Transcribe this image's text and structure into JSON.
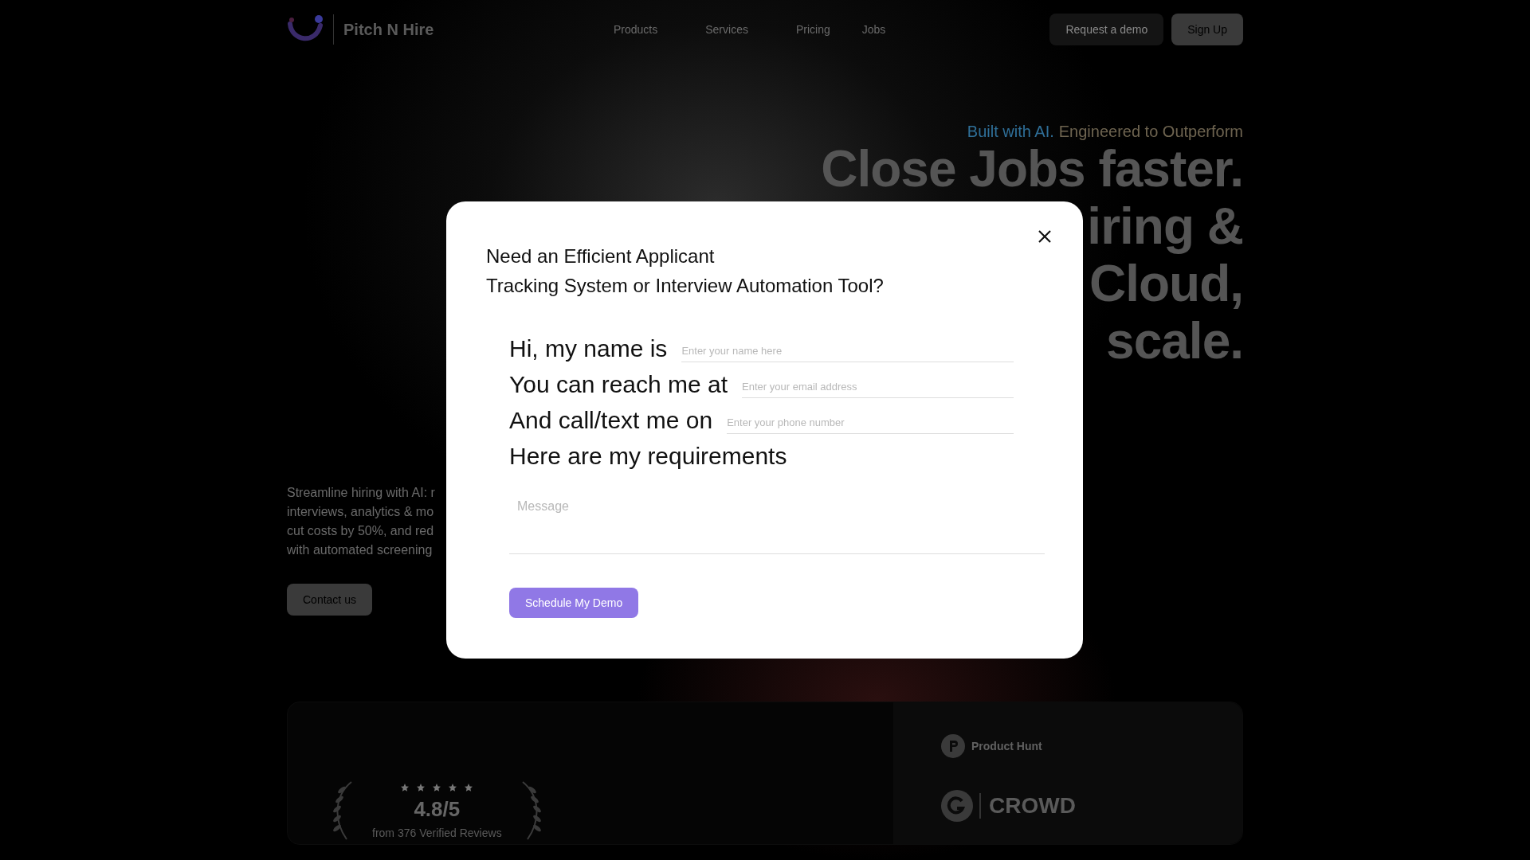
{
  "header": {
    "brand": "Pitch N Hire",
    "nav": [
      "Products",
      "Services",
      "Pricing",
      "Jobs"
    ],
    "buttons": [
      {
        "label": "Request a demo",
        "kind": "secondary"
      },
      {
        "label": "Sign Up",
        "kind": "primary"
      }
    ]
  },
  "hero": {
    "tagline_parts": [
      "Built with AI.",
      "Engineered to Outperform"
    ],
    "headline_lines": [
      "Close Jobs faster.",
      "iring &",
      "Cloud,",
      "scale."
    ],
    "description_lines": [
      "Streamline hiring with AI: r",
      "interviews, analytics & mo",
      "cut costs by 50%, and red",
      "with automated screening"
    ],
    "cta": "Contact us"
  },
  "ratings": {
    "stars": 5,
    "score": "4.8/5",
    "reviews": "from 376 Verified Reviews",
    "badges": [
      {
        "kind": "producthunt",
        "label": "Product Hunt"
      },
      {
        "kind": "g2",
        "label": "CROWD"
      }
    ]
  },
  "modal": {
    "title_lines": [
      "Need an Efficient Applicant",
      "Tracking System or Interview Automation Tool?"
    ],
    "fields": [
      {
        "label": "Hi, my name is",
        "placeholder": "Enter your name here"
      },
      {
        "label": "You can reach me at",
        "placeholder": "Enter your email address"
      },
      {
        "label": "And call/text me on",
        "placeholder": "Enter your phone number"
      }
    ],
    "requirements_label": "Here are my requirements",
    "message_placeholder": "Message",
    "submit": "Schedule My Demo"
  }
}
